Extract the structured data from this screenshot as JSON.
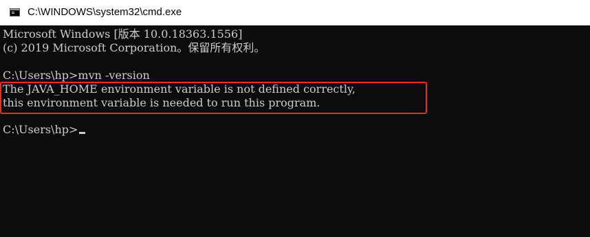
{
  "window": {
    "title": "C:\\WINDOWS\\system32\\cmd.exe",
    "icon": "cmd-console-icon"
  },
  "console": {
    "lines": [
      "Microsoft Windows [版本 10.0.18363.1556]",
      "(c) 2019 Microsoft Corporation。保留所有权利。",
      "C:\\Users\\hp>mvn -version",
      "The JAVA_HOME environment variable is not defined correctly,",
      "this environment variable is needed to run this program.",
      "C:\\Users\\hp>"
    ]
  },
  "colors": {
    "console_background": "#0c0c0c",
    "console_text": "#cccccc",
    "highlight_border": "#e8301c",
    "titlebar_background": "#ffffff"
  }
}
